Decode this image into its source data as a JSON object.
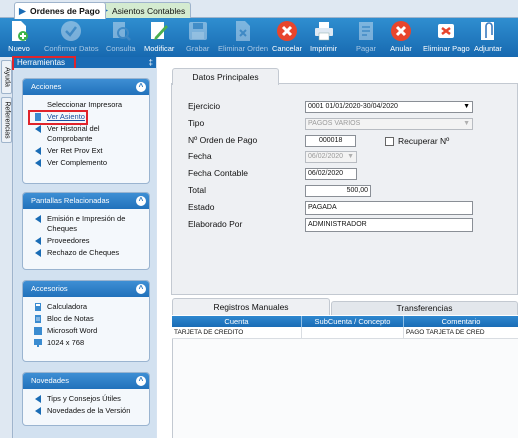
{
  "tabs": [
    {
      "label": "Ordenes de Pago",
      "active": true
    },
    {
      "label": "Asientos Contables",
      "active": false
    }
  ],
  "toolbar": {
    "nuevo": "Nuevo",
    "confirmar": "Confirmar Datos",
    "consulta": "Consulta",
    "modificar": "Modificar",
    "grabar": "Grabar",
    "eliminar_orden": "Eliminar Orden",
    "cancelar": "Cancelar",
    "imprimir": "Imprimir",
    "pagar": "Pagar",
    "anular": "Anular",
    "eliminar_pago": "Eliminar Pago",
    "adjuntar": "Adjuntar"
  },
  "side_tabs": {
    "ayuda": "Ayuda",
    "referencias": "Referencias"
  },
  "panel": {
    "title": "Herramientas",
    "pin": "‡",
    "groups": {
      "acciones": {
        "title": "Acciones",
        "items": [
          "Seleccionar Impresora",
          "Ver Asiento",
          "Ver Historial del Comprobante",
          "Ver Ret Prov Ext",
          "Ver Complemento"
        ]
      },
      "pantallas": {
        "title": "Pantallas Relacionadas",
        "items": [
          "Emisión e Impresión de Cheques",
          "Proveedores",
          "Rechazo de Cheques"
        ]
      },
      "accesorios": {
        "title": "Accesorios",
        "items": [
          "Calculadora",
          "Bloc de Notas",
          "Microsoft Word",
          "1024 x 768"
        ]
      },
      "novedades": {
        "title": "Novedades",
        "items": [
          "Tips y Consejos Útiles",
          "Novedades de la Versión"
        ]
      }
    }
  },
  "form": {
    "tab": "Datos Principales",
    "labels": {
      "ejercicio": "Ejercicio",
      "tipo": "Tipo",
      "orden": "Nº Orden de Pago",
      "fecha": "Fecha",
      "fecha_contable": "Fecha Contable",
      "total": "Total",
      "estado": "Estado",
      "elaborado": "Elaborado Por",
      "recuperar": "Recuperar Nº"
    },
    "values": {
      "ejercicio": "0001 01/01/2020-30/04/2020",
      "tipo": "PAGOS VARIOS",
      "orden": "000018",
      "fecha": "06/02/2020",
      "fecha_contable": "06/02/2020",
      "total": "500,00",
      "estado": "PAGADA",
      "elaborado": "ADMINISTRADOR"
    }
  },
  "bottom_tabs": [
    "Registros Manuales",
    "Transferencias"
  ],
  "grid": {
    "columns": [
      "Cuenta",
      "SubCuenta / Concepto",
      "Comentario"
    ],
    "rows": [
      [
        "TARJETA DE CREDITO",
        "",
        "PAGO TARJETA DE CRED"
      ]
    ]
  },
  "colors": {
    "accent": "#1a6cb5",
    "highlight": "#e0242c"
  }
}
